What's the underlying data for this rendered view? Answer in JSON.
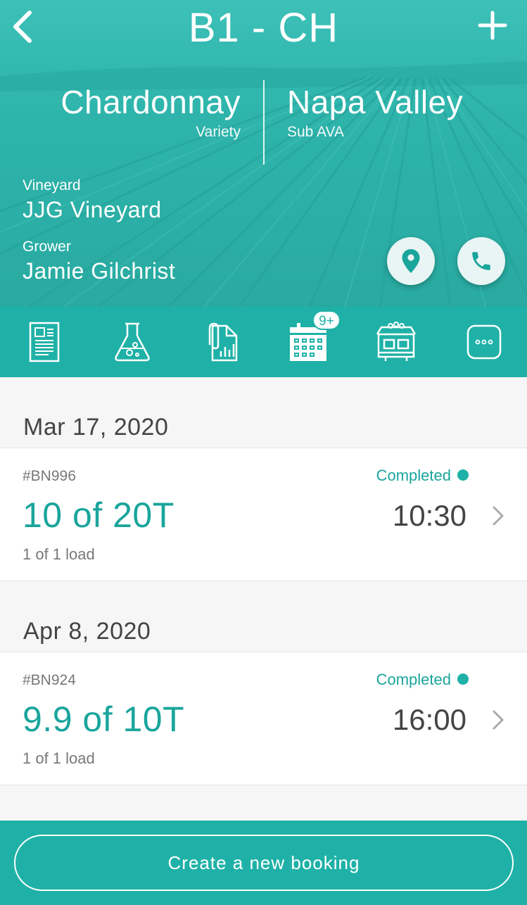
{
  "header": {
    "title": "B1 - CH",
    "variety": {
      "value": "Chardonnay",
      "label": "Variety"
    },
    "sub_ava": {
      "value": "Napa Valley",
      "label": "Sub AVA"
    },
    "vineyard": {
      "label": "Vineyard",
      "value": "JJG Vineyard"
    },
    "grower": {
      "label": "Grower",
      "value": "Jamie Gilchrist"
    },
    "back_icon": "chevron-left-icon",
    "add_icon": "plus-icon",
    "actions": [
      {
        "name": "location",
        "icon": "map-pin-icon"
      },
      {
        "name": "call",
        "icon": "phone-icon"
      }
    ]
  },
  "toolbar": {
    "tabs": [
      {
        "name": "notes",
        "icon": "document-icon"
      },
      {
        "name": "lab",
        "icon": "flask-icon"
      },
      {
        "name": "attachments",
        "icon": "paperclip-chart-icon"
      },
      {
        "name": "bookings",
        "icon": "calendar-icon",
        "active": true,
        "badge": "9+"
      },
      {
        "name": "winery",
        "icon": "winery-building-icon"
      },
      {
        "name": "more",
        "icon": "more-icon"
      }
    ]
  },
  "bookings": [
    {
      "date": "Mar 17, 2020",
      "id": "#BN996",
      "status": "Completed",
      "amount": "10 of 20T",
      "time": "10:30",
      "loads": "1 of 1 load"
    },
    {
      "date": "Apr 8, 2020",
      "id": "#BN924",
      "status": "Completed",
      "amount": "9.9 of 10T",
      "time": "16:00",
      "loads": "1 of 1 load"
    }
  ],
  "footer": {
    "create_label": "Create a new booking"
  },
  "colors": {
    "accent": "#1fb1a7",
    "accent_text": "#1aa59c",
    "hero": "#3dc2b9",
    "status_completed": "#1fb1a7"
  }
}
